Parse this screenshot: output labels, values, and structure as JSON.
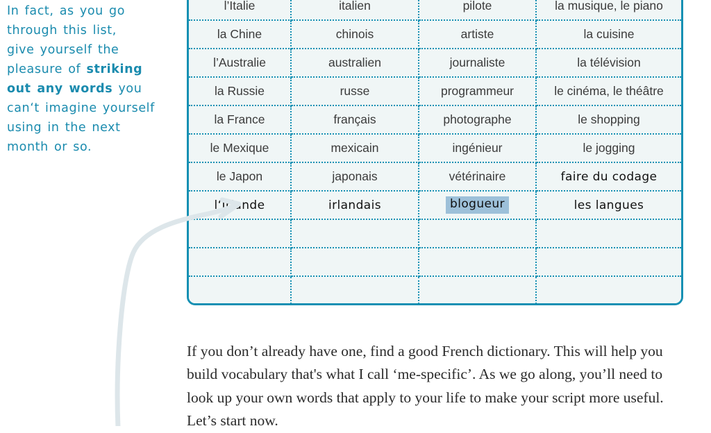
{
  "note": {
    "lines": [
      {
        "segments": [
          {
            "text": "In fact, as you go",
            "bold": false
          }
        ]
      },
      {
        "segments": [
          {
            "text": "through this list,",
            "bold": false
          }
        ]
      },
      {
        "segments": [
          {
            "text": "give yourself the",
            "bold": false
          }
        ]
      },
      {
        "segments": [
          {
            "text": "pleasure of ",
            "bold": false
          },
          {
            "text": "striking",
            "bold": true
          }
        ]
      },
      {
        "segments": [
          {
            "text": "out any words",
            "bold": true
          },
          {
            "text": " you",
            "bold": false
          }
        ]
      },
      {
        "segments": [
          {
            "text": "can‘t imagine yourself",
            "bold": false
          }
        ]
      },
      {
        "segments": [
          {
            "text": "using in the next",
            "bold": false
          }
        ]
      },
      {
        "segments": [
          {
            "text": "month or so.",
            "bold": false
          }
        ]
      }
    ],
    "full_text": "In fact, as you go through this list, give yourself the pleasure of striking out any words you can‘t imagine yourself using in the next month or so.",
    "color": "#1A8BAE"
  },
  "table": {
    "border_color": "#1590B3",
    "cell_background": "#F0F6F6",
    "highlight_color": "#9DC0D9",
    "rows": [
      {
        "style": "print",
        "cells": [
          "l’Italie",
          "italien",
          "pilote",
          "la musique, le piano"
        ]
      },
      {
        "style": "print",
        "cells": [
          "la Chine",
          "chinois",
          "artiste",
          "la cuisine"
        ]
      },
      {
        "style": "print",
        "cells": [
          "l’Australie",
          "australien",
          "journaliste",
          "la télévision"
        ]
      },
      {
        "style": "print",
        "cells": [
          "la Russie",
          "russe",
          "programmeur",
          "le cinéma, le théâtre"
        ]
      },
      {
        "style": "print",
        "cells": [
          "la France",
          "français",
          "photographe",
          "le shopping"
        ]
      },
      {
        "style": "print",
        "cells": [
          "le Mexique",
          "mexicain",
          "ingénieur",
          "le jogging"
        ]
      },
      {
        "style": "mixed",
        "cells": [
          "le Japon",
          "japonais",
          "vétérinaire",
          "faire du codage"
        ],
        "cell_styles": [
          "print",
          "print",
          "print",
          "hand"
        ]
      },
      {
        "style": "mixed",
        "cells": [
          "l‘Irlande",
          "irlandais",
          "blogueur",
          "les langues"
        ],
        "cell_styles": [
          "hand",
          "hand",
          "hand-highlight",
          "hand"
        ]
      },
      {
        "style": "empty",
        "cells": [
          "",
          "",
          "",
          ""
        ]
      },
      {
        "style": "empty",
        "cells": [
          "",
          "",
          "",
          ""
        ]
      },
      {
        "style": "empty",
        "cells": [
          "",
          "",
          "",
          ""
        ]
      }
    ]
  },
  "paragraph": {
    "text": "If you don’t already have one, find a good French dictionary. This will help you build vocabulary that's what I call ‘me-specific’. As we go along, you’ll need to look up your own words that apply to your life to make your script more useful. Let’s start now."
  },
  "pointer": {
    "color": "#DDE6EA",
    "description": "curved arrow pointing from lower-left up to the l‘Irlande cell"
  }
}
